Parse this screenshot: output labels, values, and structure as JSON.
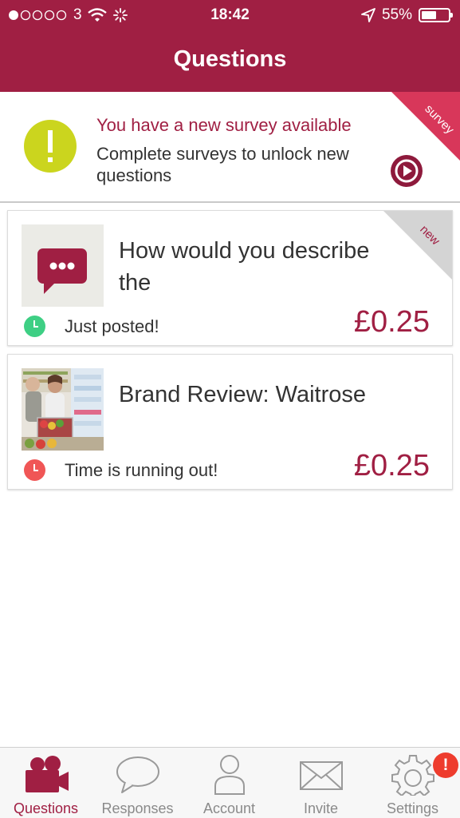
{
  "status_bar": {
    "carrier": "3",
    "time": "18:42",
    "battery_percent": "55%",
    "battery_level": 0.55
  },
  "header": {
    "title": "Questions"
  },
  "survey_banner": {
    "title": "You have a new survey available",
    "text": "Complete surveys to unlock new questions",
    "ribbon": "survey",
    "icon": "exclamation-icon",
    "accent_color": "#a01f43",
    "icon_color": "#cbd51e"
  },
  "questions": [
    {
      "title": "How would you describe the",
      "status": "Just posted!",
      "status_color": "#3ecf84",
      "price": "£0.25",
      "ribbon": "new",
      "thumbnail": "chat-bubble-icon"
    },
    {
      "title": "Brand Review: Waitrose",
      "status": "Time is running out!",
      "status_color": "#f05656",
      "price": "£0.25",
      "thumbnail": "shopping-photo"
    }
  ],
  "tabs": [
    {
      "label": "Questions",
      "icon": "camera-icon",
      "active": true
    },
    {
      "label": "Responses",
      "icon": "speech-bubble-icon",
      "active": false
    },
    {
      "label": "Account",
      "icon": "person-icon",
      "active": false
    },
    {
      "label": "Invite",
      "icon": "envelope-icon",
      "active": false
    },
    {
      "label": "Settings",
      "icon": "gear-icon",
      "active": false,
      "badge": "!"
    }
  ]
}
